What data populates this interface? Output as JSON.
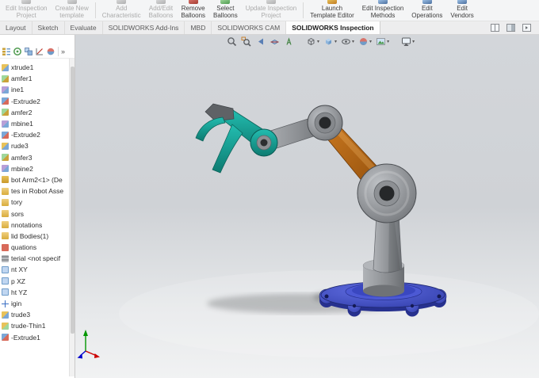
{
  "ribbon": {
    "items": [
      {
        "line1": "Edit Inspection",
        "line2": "Project",
        "enabled": false
      },
      {
        "line1": "Create New",
        "line2": "template",
        "enabled": false
      },
      {
        "line1": "Add",
        "line2": "Characteristic",
        "enabled": false
      },
      {
        "line1": "Add/Edit",
        "line2": "Balloons",
        "enabled": false
      },
      {
        "line1": "Remove",
        "line2": "Balloons",
        "enabled": true
      },
      {
        "line1": "Select",
        "line2": "Balloons",
        "enabled": true
      },
      {
        "line1": "Update Inspection",
        "line2": "Project",
        "enabled": false
      },
      {
        "line1": "Launch",
        "line2": "Template Editor",
        "enabled": true
      },
      {
        "line1": "Edit Inspection",
        "line2": "Methods",
        "enabled": true
      },
      {
        "line1": "Edit",
        "line2": "Operations",
        "enabled": true
      },
      {
        "line1": "Edit",
        "line2": "Vendors",
        "enabled": true
      }
    ]
  },
  "tabs": {
    "items": [
      {
        "label": "Layout",
        "active": false
      },
      {
        "label": "Sketch",
        "active": false
      },
      {
        "label": "Evaluate",
        "active": false
      },
      {
        "label": "SOLIDWORKS Add-Ins",
        "active": false
      },
      {
        "label": "MBD",
        "active": false
      },
      {
        "label": "SOLIDWORKS CAM",
        "active": false
      },
      {
        "label": "SOLIDWORKS Inspection",
        "active": true
      }
    ],
    "strip_icons": [
      "split-pane-icon",
      "display-pane-icon",
      "collapse-pane-icon"
    ]
  },
  "headsup_toolbar": {
    "dropdown_glyph": "▾",
    "icons": [
      "zoom-fit",
      "zoom-area",
      "previous-view",
      "section-view",
      "annotation-view",
      "view-orientation",
      "display-style",
      "hide-show-items",
      "edit-appearance",
      "apply-scene",
      "view-settings"
    ]
  },
  "feature_panel": {
    "toolbar_icons": [
      "featuremanager-tree-icon",
      "propertymanager-icon",
      "configurationmanager-icon",
      "dimxpertmanager-icon",
      "displaymanager-icon"
    ],
    "chevron": "»",
    "tree_items": [
      {
        "label": "xtrude1",
        "icon": "boss-extrude-icon"
      },
      {
        "label": "amfer1",
        "icon": "chamfer-icon"
      },
      {
        "label": "ine1",
        "icon": "combine-icon"
      },
      {
        "label": "-Extrude2",
        "icon": "cut-extrude-icon"
      },
      {
        "label": "amfer2",
        "icon": "chamfer-icon"
      },
      {
        "label": "mbine1",
        "icon": "combine-icon"
      },
      {
        "label": "-Extrude2",
        "icon": "cut-extrude-icon"
      },
      {
        "label": "rude3",
        "icon": "boss-extrude-icon"
      },
      {
        "label": "amfer3",
        "icon": "chamfer-icon"
      },
      {
        "label": "mbine2",
        "icon": "combine-icon"
      },
      {
        "label": "bot Arm2<1> (De",
        "icon": "component-icon"
      },
      {
        "label": "tes in Robot Asse",
        "icon": "mates-folder-icon"
      },
      {
        "label": "tory",
        "icon": "history-folder-icon"
      },
      {
        "label": "sors",
        "icon": "sensors-folder-icon"
      },
      {
        "label": "nnotations",
        "icon": "annotations-folder-icon"
      },
      {
        "label": "lid Bodies(1)",
        "icon": "solid-bodies-folder-icon"
      },
      {
        "label": "quations",
        "icon": "equations-icon"
      },
      {
        "label": "terial <not specif",
        "icon": "material-icon"
      },
      {
        "label": "nt XY",
        "icon": "plane-icon"
      },
      {
        "label": "p XZ",
        "icon": "plane-icon"
      },
      {
        "label": "ht YZ",
        "icon": "plane-icon"
      },
      {
        "label": "igin",
        "icon": "origin-icon"
      },
      {
        "label": "trude3",
        "icon": "boss-extrude-icon"
      },
      {
        "label": "trude-Thin1",
        "icon": "extrude-thin-icon"
      },
      {
        "label": "-Extrude1",
        "icon": "cut-extrude-icon"
      }
    ]
  },
  "viewport": {
    "model": "robot-arm-assembly",
    "colors": {
      "bg_top": "#d3d6da",
      "bg_bottom": "#f1f2f3",
      "base_blue": "#4150c8",
      "base_blue_dark": "#27318f",
      "link_orange": "#b4621a",
      "link_orange_dark": "#6e3a06",
      "gripper_teal": "#16a89c",
      "gripper_teal_dark": "#0b6158",
      "metal_light": "#b0b3b7",
      "metal": "#84878b",
      "metal_dark": "#4f5256",
      "triad_x": "#cc0000",
      "triad_y": "#009600",
      "triad_z": "#0000cc"
    }
  }
}
